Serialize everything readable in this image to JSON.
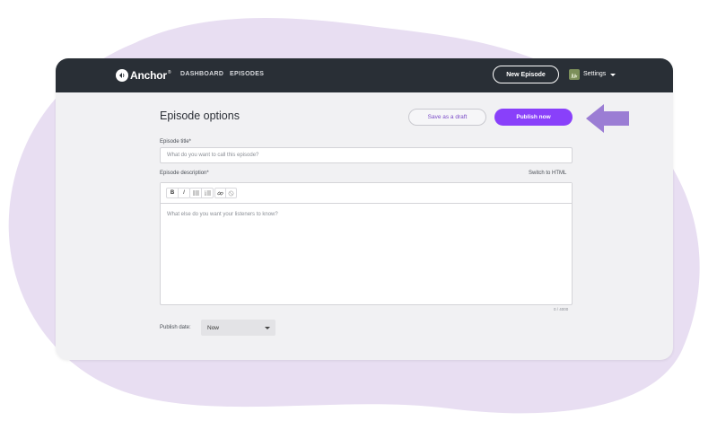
{
  "app": {
    "brand": "Anchor",
    "brand_reg": "®"
  },
  "nav": {
    "items": [
      {
        "label": "DASHBOARD"
      },
      {
        "label": "EPISODES"
      }
    ]
  },
  "header": {
    "new_episode_label": "New Episode",
    "settings_label": "Settings"
  },
  "page": {
    "title": "Episode options"
  },
  "actions": {
    "draft_label": "Save as a draft",
    "publish_label": "Publish now"
  },
  "form": {
    "title_label": "Episode title*",
    "title_placeholder": "What do you want to call this episode?",
    "description_label": "Episode description*",
    "switch_html_label": "Switch to HTML",
    "description_placeholder": "What else do you want your listeners to know?",
    "char_count": "0 / 4000",
    "publish_date_label": "Publish date:",
    "publish_date_value": "Now"
  },
  "toolbar": {
    "bold": "B",
    "italic": "I",
    "icons": [
      "bold-icon",
      "italic-icon",
      "bulleted-list-icon",
      "numbered-list-icon",
      "link-icon",
      "unlink-icon"
    ]
  },
  "colors": {
    "accent": "#8940fa",
    "header_bg": "#292f36",
    "blob": "#e8def2",
    "arrow": "#9b7dd4"
  }
}
